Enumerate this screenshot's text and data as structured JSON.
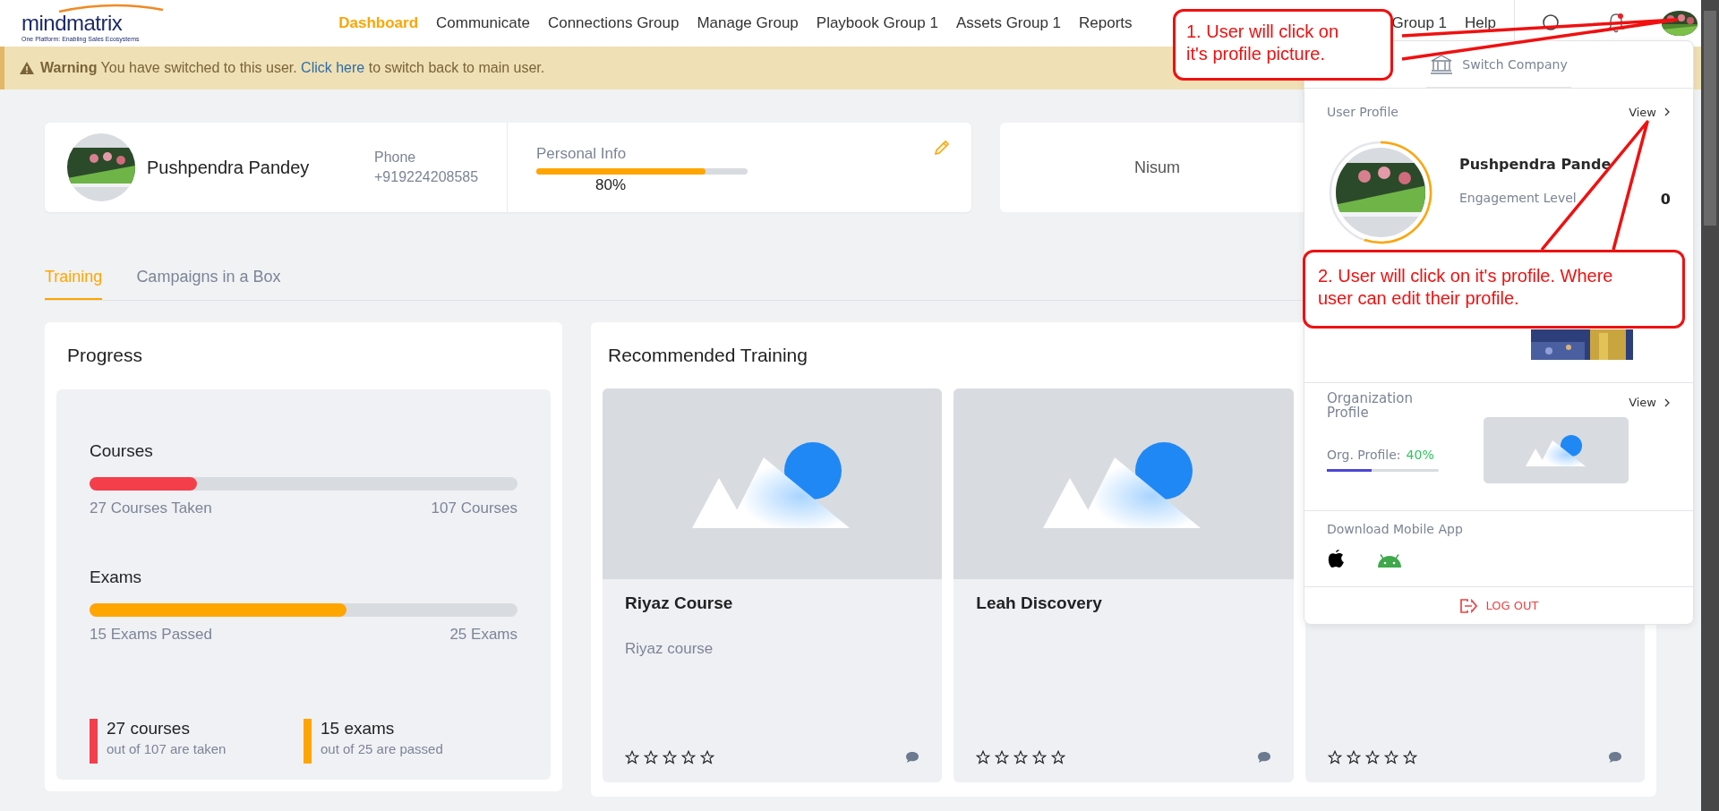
{
  "header": {
    "logo": {
      "name": "mindmatrix",
      "tagline": "One Platform: Enabling Sales Ecosystems"
    },
    "nav": [
      {
        "label": "Dashboard",
        "selected": true
      },
      {
        "label": "Communicate",
        "selected": false
      },
      {
        "label": "Connections Group",
        "selected": false
      },
      {
        "label": "Manage Group",
        "selected": false
      },
      {
        "label": "Playbook Group 1",
        "selected": false
      },
      {
        "label": "Assets Group 1",
        "selected": false
      },
      {
        "label": "Reports",
        "selected": false
      }
    ],
    "nav_after_callout": [
      {
        "label": "Group 1",
        "selected": false
      },
      {
        "label": "Help",
        "selected": false
      }
    ],
    "notifications": {
      "unread": true
    }
  },
  "warning": {
    "title": "Warning",
    "before": "You have switched to this user.",
    "link": "Click here",
    "after": "to switch back to main user."
  },
  "profile_card": {
    "name": "Pushpendra Pandey",
    "phone_label": "Phone",
    "phone": "+919224208585",
    "personal_info": {
      "label": "Personal Info",
      "level": 0.8,
      "percent": "80%"
    }
  },
  "company_card": {
    "name": "Nisum"
  },
  "tabs": [
    {
      "label": "Training",
      "selected": true
    },
    {
      "label": "Campaigns in a Box",
      "selected": false
    }
  ],
  "progress": {
    "title": "Progress",
    "meters": [
      {
        "label": "Courses",
        "level": 0.25,
        "color": "#f43f4b",
        "done": "27 Courses Taken",
        "total": "107 Courses"
      },
      {
        "label": "Exams",
        "level": 0.6,
        "color": "#ffa500",
        "done": "15 Exams Passed",
        "total": "25 Exams"
      }
    ],
    "summary": [
      {
        "count": "27 courses",
        "detail": "out of 107 are taken",
        "color": "#f43f4b"
      },
      {
        "count": "15 exams",
        "detail": "out of 25 are passed",
        "color": "#ffa500"
      }
    ]
  },
  "recommended": {
    "title": "Recommended Training",
    "courses": [
      {
        "title": "Riyaz Course",
        "description": "Riyaz course",
        "stars": 0
      },
      {
        "title": "Leah Discovery",
        "stars": 0
      },
      {
        "stars": 0
      }
    ]
  },
  "profile_menu": {
    "switch_company": "Switch Company",
    "user_profile": {
      "heading": "User Profile",
      "view": "View",
      "name": "Pushpendra Pande",
      "engagement_label": "Engagement Level",
      "engagement": "0"
    },
    "organization": {
      "heading": "Organization Profile",
      "view": "View",
      "progress_label": "Org. Profile:",
      "percent": "40%",
      "level": 0.4
    },
    "download_label": "Download Mobile App",
    "logout": "LOG OUT"
  },
  "callouts": [
    {
      "text": "1. User will click on it's profile picture."
    },
    {
      "text": "2. User will click on it's profile. Where user can edit their profile."
    }
  ]
}
